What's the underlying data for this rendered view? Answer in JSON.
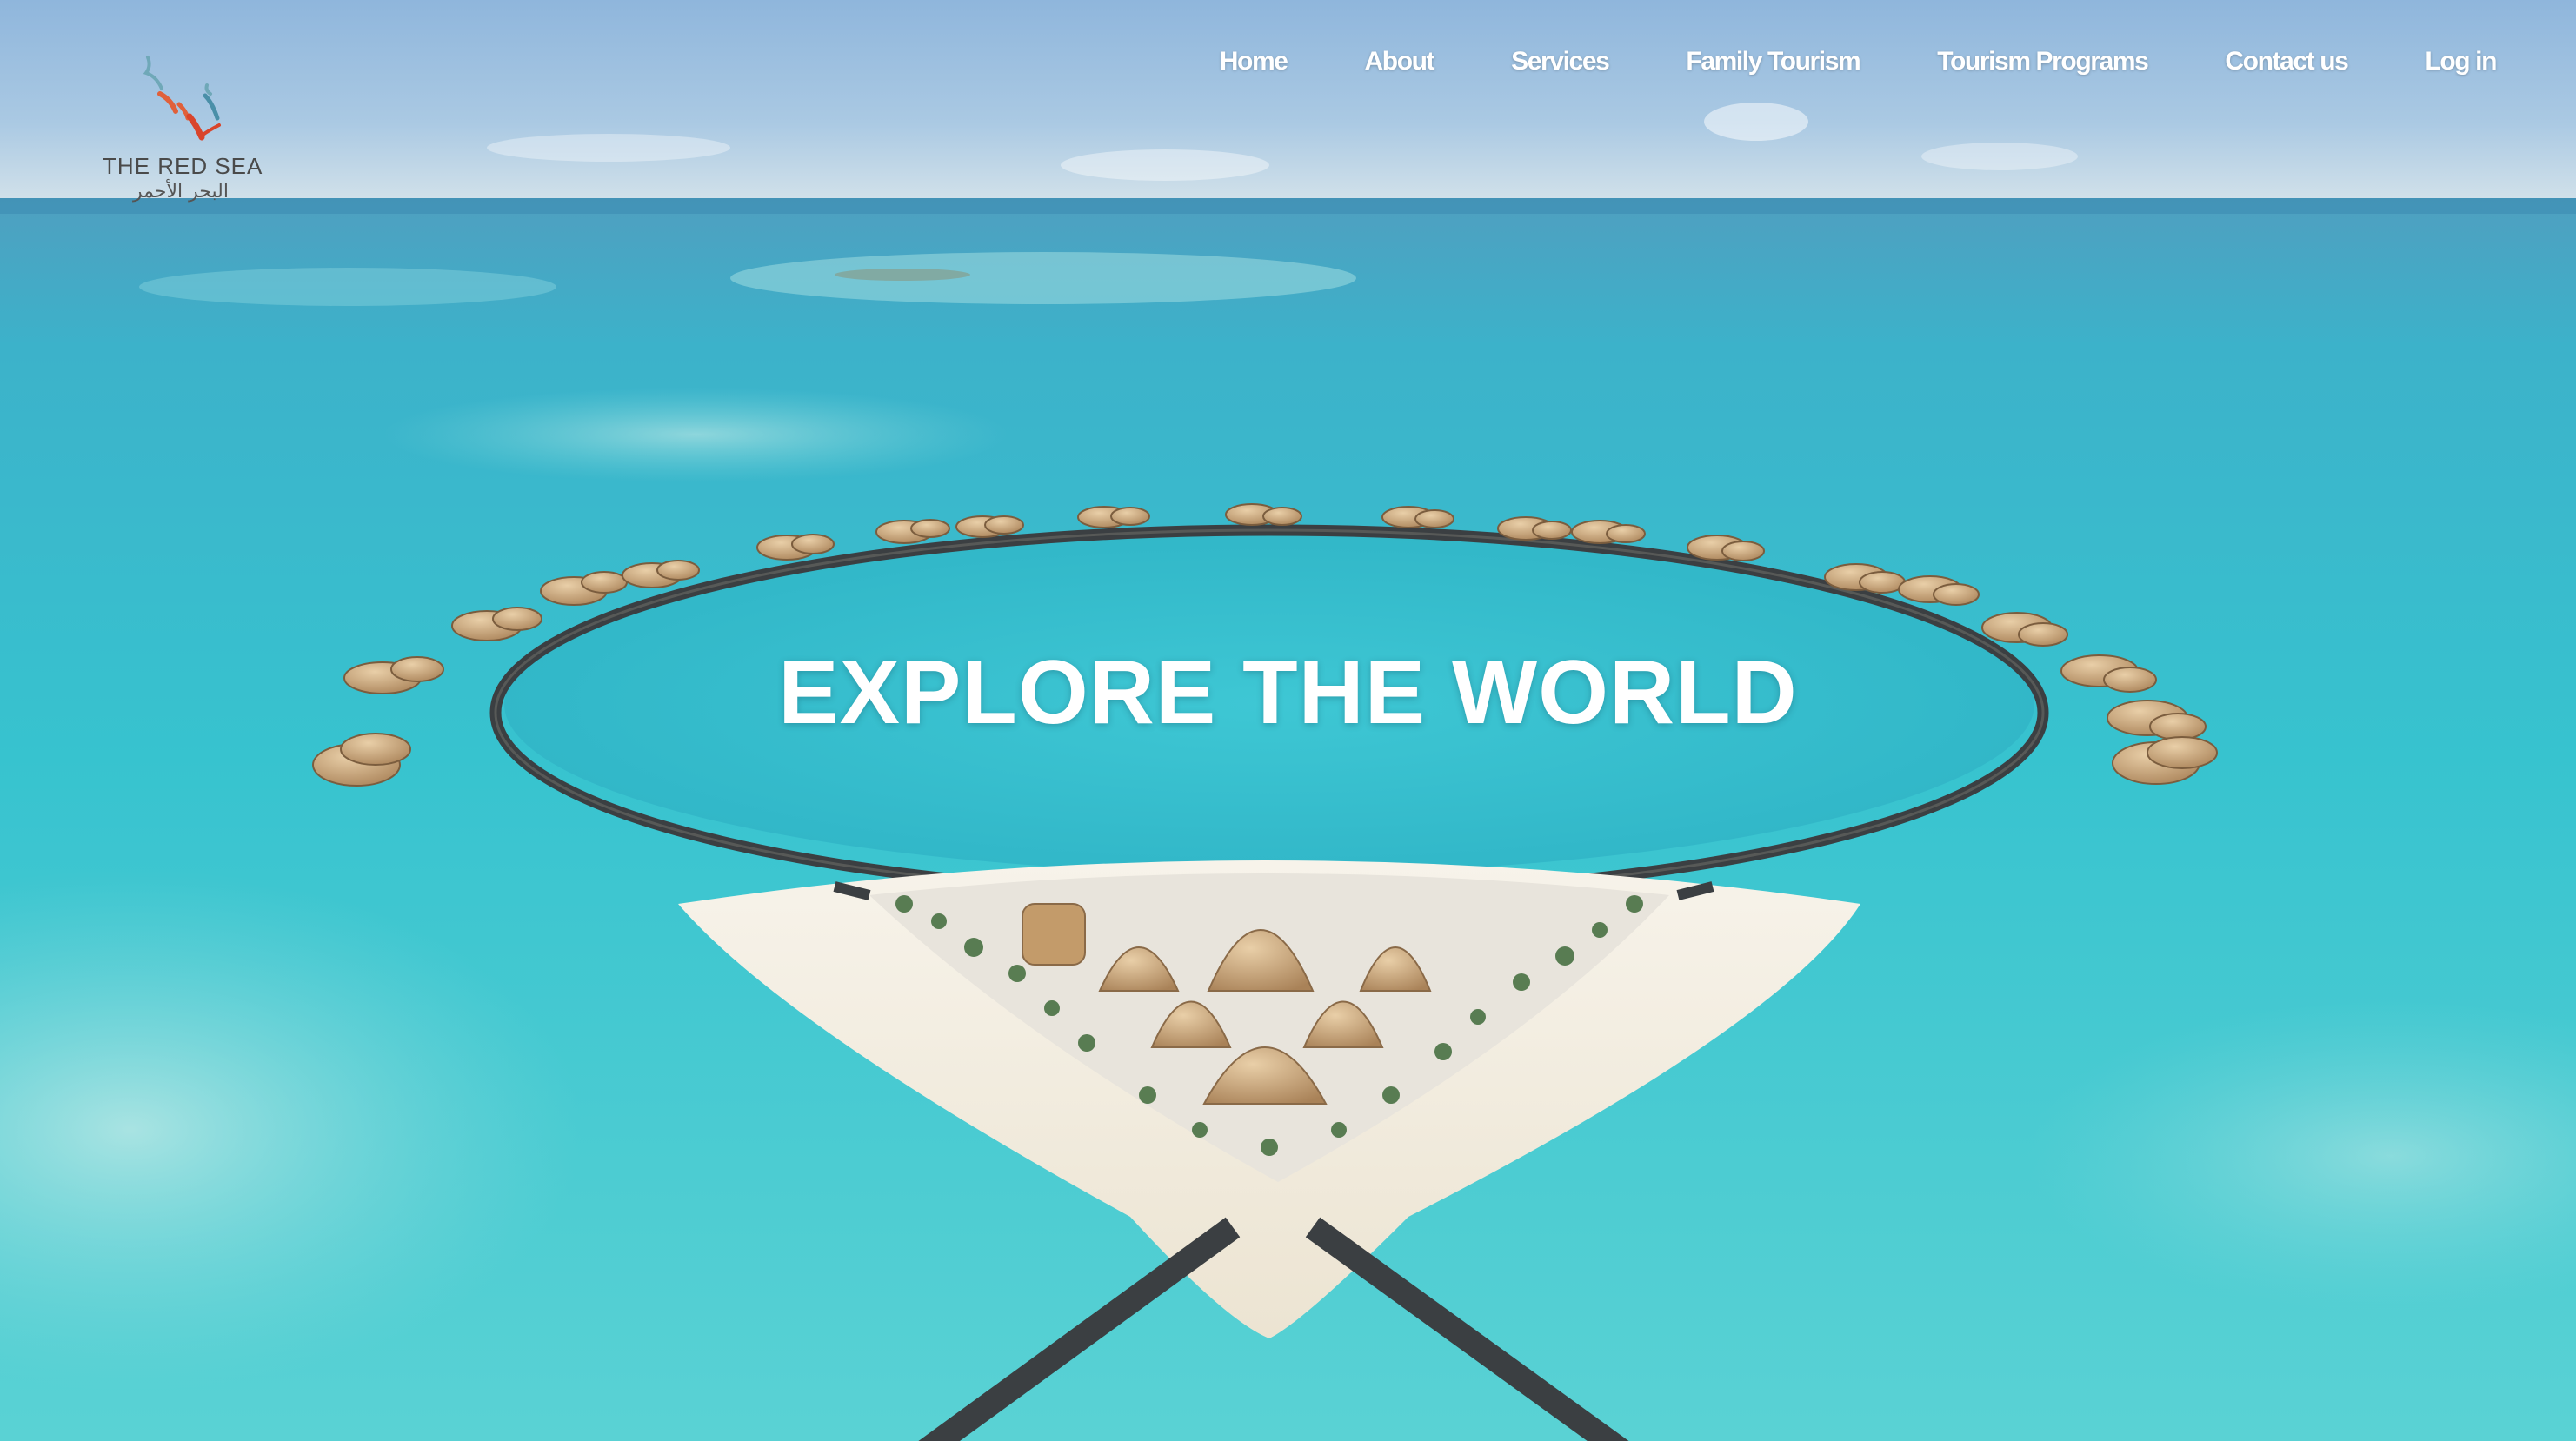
{
  "logo": {
    "name_en": "THE RED SEA",
    "name_ar": "البحر الأحمر",
    "colors": [
      "#6fa8b8",
      "#e0603a",
      "#d9442b",
      "#4a8fa8"
    ]
  },
  "nav": {
    "items": [
      {
        "label": "Home"
      },
      {
        "label": "About"
      },
      {
        "label": "Services"
      },
      {
        "label": "Family Tourism"
      },
      {
        "label": "Tourism Programs"
      },
      {
        "label": "Contact us"
      },
      {
        "label": "Log in"
      }
    ]
  },
  "hero": {
    "headline": "EXPLORE THE WORLD",
    "background_image": "aerial-island-resort-ring-of-villas",
    "colors": {
      "sky": "#9cc1df",
      "sea": "#39c3cf",
      "sand": "#f3efe6"
    }
  }
}
